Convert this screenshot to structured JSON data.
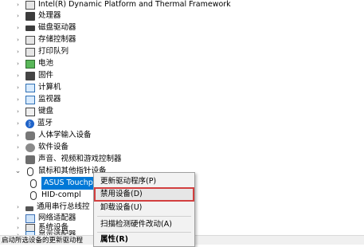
{
  "tree": {
    "items": [
      {
        "label": "Intel(R) Dynamic Platform and Thermal Framework",
        "arrow": "›",
        "icon": "chip-icon"
      },
      {
        "label": "处理器",
        "arrow": "›",
        "icon": "processor-icon"
      },
      {
        "label": "磁盘驱动器",
        "arrow": "›",
        "icon": "disk-icon"
      },
      {
        "label": "存储控制器",
        "arrow": "›",
        "icon": "storage-controller-icon"
      },
      {
        "label": "打印队列",
        "arrow": "›",
        "icon": "printer-icon"
      },
      {
        "label": "电池",
        "arrow": "›",
        "icon": "battery-icon"
      },
      {
        "label": "固件",
        "arrow": "›",
        "icon": "firmware-icon"
      },
      {
        "label": "计算机",
        "arrow": "›",
        "icon": "computer-icon"
      },
      {
        "label": "监视器",
        "arrow": "›",
        "icon": "monitor-icon"
      },
      {
        "label": "键盘",
        "arrow": "›",
        "icon": "keyboard-icon"
      },
      {
        "label": "蓝牙",
        "arrow": "›",
        "icon": "bluetooth-icon"
      },
      {
        "label": "人体学输入设备",
        "arrow": "›",
        "icon": "hid-icon"
      },
      {
        "label": "软件设备",
        "arrow": "›",
        "icon": "software-device-icon"
      },
      {
        "label": "声音、视频和游戏控制器",
        "arrow": "›",
        "icon": "speaker-icon"
      },
      {
        "label": "鼠标和其他指针设备",
        "arrow": "⌄",
        "icon": "mouse-icon"
      },
      {
        "label": "ASUS Touchpad",
        "arrow": "",
        "icon": "mouse-icon"
      },
      {
        "label": "HID-compl",
        "arrow": "",
        "icon": "mouse-icon"
      },
      {
        "label": "通用串行总线控",
        "arrow": "›",
        "icon": "usb-icon"
      },
      {
        "label": "网络适配器",
        "arrow": "›",
        "icon": "network-adapter-icon"
      },
      {
        "label": "系统设备",
        "arrow": "›",
        "icon": "system-device-icon"
      },
      {
        "label": "显示适配器",
        "arrow": "›",
        "icon": "display-adapter-icon"
      }
    ]
  },
  "context_menu": {
    "items": [
      {
        "label": "更新驱动程序(P)"
      },
      {
        "label": "禁用设备(D)"
      },
      {
        "label": "卸载设备(U)"
      },
      {
        "label": "扫描检测硬件改动(A)"
      },
      {
        "label": "属性(R)"
      }
    ]
  },
  "status_bar": {
    "text": "启动所选设备的更新驱动程"
  },
  "colors": {
    "selection": "#0078d7",
    "menu_highlight_border": "#d23f3f",
    "menu_bg": "#f2f2f2"
  }
}
